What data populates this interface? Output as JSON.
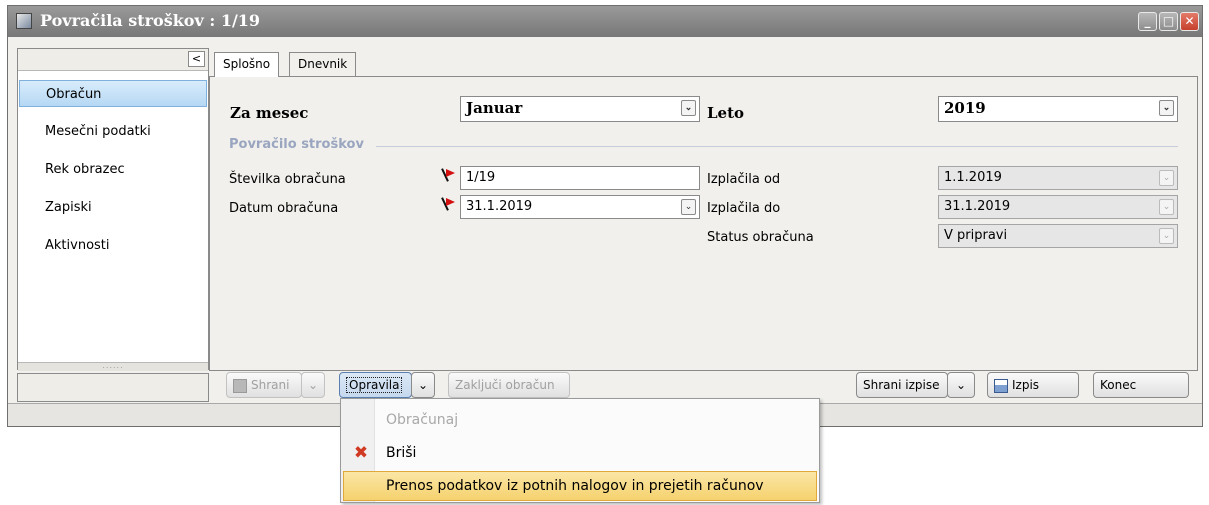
{
  "window": {
    "title": "Povračila stroškov : 1/19",
    "controls": {
      "minimize": "_",
      "maximize": "□",
      "close": "✕"
    }
  },
  "sidebar": {
    "collapse_glyph": "<",
    "items": [
      {
        "label": "Obračun",
        "selected": true
      },
      {
        "label": "Mesečni podatki"
      },
      {
        "label": "Rek obrazec"
      },
      {
        "label": "Zapiski"
      },
      {
        "label": "Aktivnosti"
      }
    ],
    "splitter_grip": "......"
  },
  "tabs": [
    {
      "label": "Splošno",
      "active": true
    },
    {
      "label": "Dnevnik"
    }
  ],
  "form": {
    "za_mesec": {
      "label": "Za mesec",
      "value": "Januar"
    },
    "leto": {
      "label": "Leto",
      "value": "2019"
    },
    "group_title": "Povračilo stroškov",
    "stevilka": {
      "label": "Številka obračuna",
      "value": "1/19"
    },
    "datum": {
      "label": "Datum obračuna",
      "value": "31.1.2019"
    },
    "izplacila_od": {
      "label": "Izplačila od",
      "value": "1.1.2019"
    },
    "izplacila_do": {
      "label": "Izplačila do",
      "value": "31.1.2019"
    },
    "status": {
      "label": "Status obračuna",
      "value": "V pripravi"
    },
    "dropdown_glyph": "⌄"
  },
  "toolbar": {
    "shrani": "Shrani",
    "opravila": "Opravila",
    "zakljuci": "Zaključi obračun",
    "shrani_izpise": "Shrani izpise",
    "izpis": "Izpis",
    "konec": "Konec"
  },
  "menu": {
    "items": [
      {
        "label": "Obračunaj",
        "disabled": true
      },
      {
        "label": "Briši",
        "icon": "delete-x-icon"
      },
      {
        "label": "Prenos podatkov iz potnih nalogov in prejetih računov",
        "highlighted": true
      }
    ]
  },
  "colors": {
    "title_bar": "#888888",
    "selection": "#b6d8f4",
    "group_title": "#9aa6c0",
    "menu_highlight": "#f5d26e",
    "required_flag": "#d21010"
  }
}
